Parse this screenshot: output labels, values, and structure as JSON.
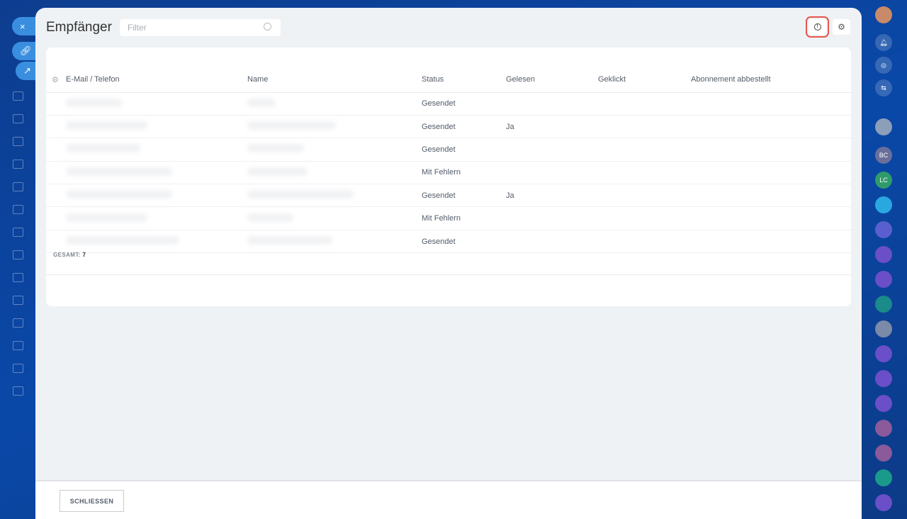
{
  "left_sidebar": {
    "close_icon": "×"
  },
  "header": {
    "title": "Empfänger",
    "filter_placeholder": "Filter"
  },
  "table": {
    "columns": [
      "E-Mail / Telefon",
      "Name",
      "Status",
      "Gelesen",
      "Geklickt",
      "Abonnement abbestellt"
    ],
    "rows": [
      {
        "status": "Gesendet",
        "read": "",
        "clicked": "",
        "unsub": ""
      },
      {
        "status": "Gesendet",
        "read": "Ja",
        "clicked": "",
        "unsub": ""
      },
      {
        "status": "Gesendet",
        "read": "",
        "clicked": "",
        "unsub": ""
      },
      {
        "status": "Mit Fehlern",
        "read": "",
        "clicked": "",
        "unsub": ""
      },
      {
        "status": "Gesendet",
        "read": "Ja",
        "clicked": "",
        "unsub": ""
      },
      {
        "status": "Mit Fehlern",
        "read": "",
        "clicked": "",
        "unsub": ""
      },
      {
        "status": "Gesendet",
        "read": "",
        "clicked": "",
        "unsub": ""
      }
    ],
    "total_label": "GESAMT:",
    "total_value": "7"
  },
  "footer": {
    "close_label": "SCHLIESSEN"
  },
  "right_sidebar": {
    "avatars": [
      "BC",
      "LC"
    ]
  }
}
